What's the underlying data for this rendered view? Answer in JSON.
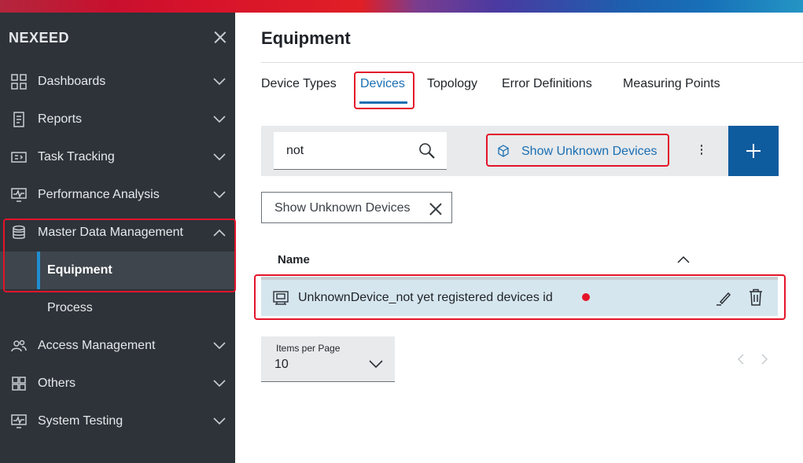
{
  "sidebar": {
    "brand": "NEXEED",
    "items": [
      {
        "label": "Dashboards",
        "icon": "dashboard-icon"
      },
      {
        "label": "Reports",
        "icon": "report-icon"
      },
      {
        "label": "Task Tracking",
        "icon": "task-tracking-icon"
      },
      {
        "label": "Performance Analysis",
        "icon": "performance-icon"
      },
      {
        "label": "Master Data Management",
        "icon": "database-icon"
      },
      {
        "label": "Access Management",
        "icon": "users-icon"
      },
      {
        "label": "Others",
        "icon": "widgets-icon"
      },
      {
        "label": "System Testing",
        "icon": "monitor-icon"
      }
    ],
    "sub_items": [
      {
        "label": "Equipment"
      },
      {
        "label": "Process"
      }
    ]
  },
  "main": {
    "title": "Equipment",
    "tabs": [
      {
        "label": "Device Types"
      },
      {
        "label": "Devices"
      },
      {
        "label": "Topology"
      },
      {
        "label": "Error Definitions"
      },
      {
        "label": "Measuring Points"
      }
    ],
    "search": {
      "value": "not"
    },
    "toolbar": {
      "unknown_devices_label": "Show Unknown Devices"
    },
    "filter_chip": {
      "label": "Show Unknown Devices"
    },
    "table": {
      "column_name": "Name",
      "rows": [
        {
          "name": "UnknownDevice_not yet registered devices id"
        }
      ]
    },
    "pagination": {
      "items_per_page_label": "Items per Page",
      "items_per_page_value": "10"
    }
  },
  "colors": {
    "sidebar_bg": "#2d3339",
    "accent_blue": "#1a6fb3",
    "add_button": "#0e5b9e",
    "highlight_red": "#e3142a",
    "selected_row": "#d6e6ee",
    "status_dot": "#e3142a"
  }
}
